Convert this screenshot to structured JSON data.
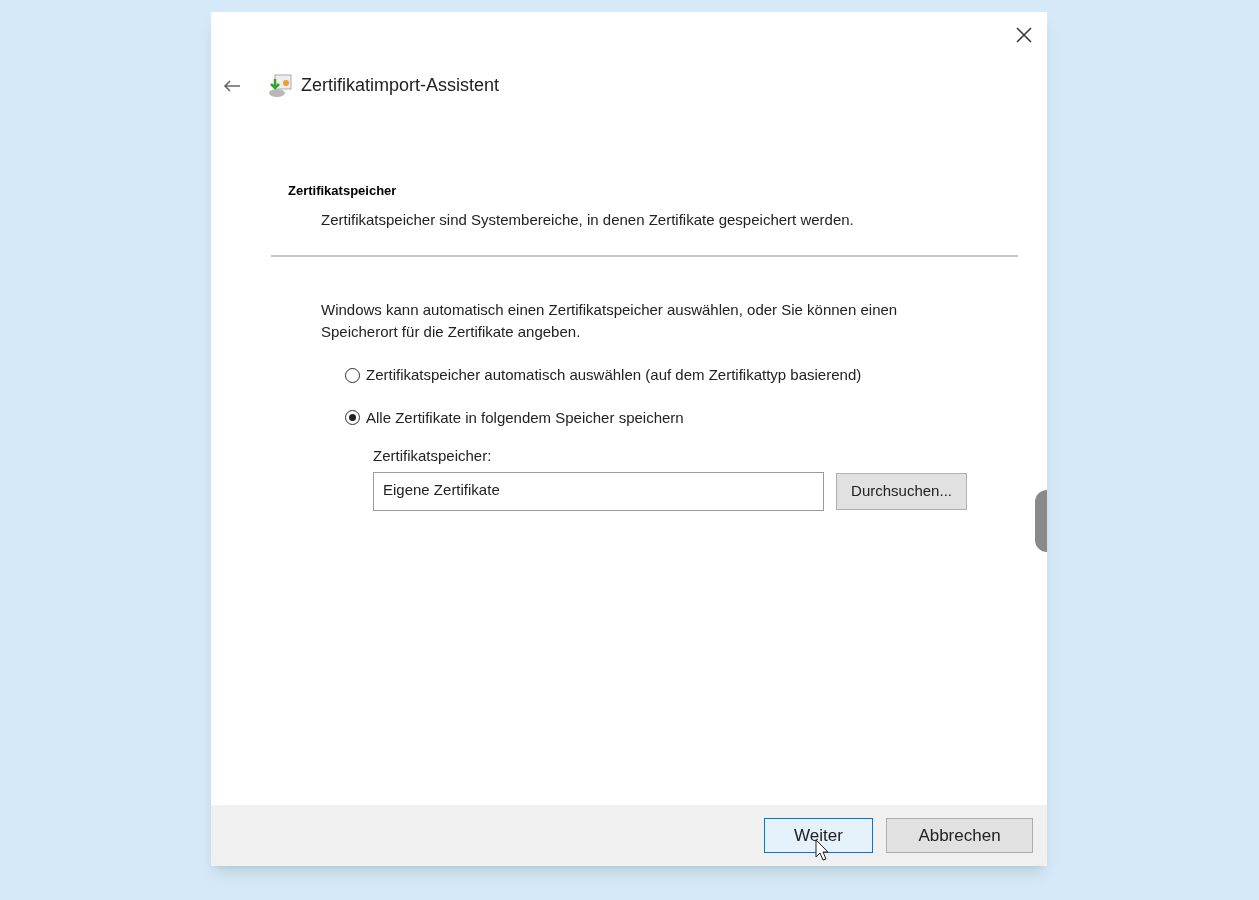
{
  "window": {
    "title": "Zertifikatimport-Assistent"
  },
  "section": {
    "heading": "Zertifikatspeicher",
    "description": "Zertifikatspeicher sind Systembereiche, in denen Zertifikate gespeichert werden."
  },
  "intro": "Windows kann automatisch einen Zertifikatspeicher auswählen, oder Sie können einen Speicherort für die Zertifikate angeben.",
  "options": [
    {
      "label": "Zertifikatspeicher automatisch auswählen (auf dem Zertifikattyp basierend)",
      "selected": false
    },
    {
      "label": "Alle Zertifikate in folgendem Speicher speichern",
      "selected": true
    }
  ],
  "store": {
    "label": "Zertifikatspeicher:",
    "value": "Eigene Zertifikate",
    "browse_button": "Durchsuchen..."
  },
  "buttons": [
    {
      "label": "Weiter",
      "focused": true
    },
    {
      "label": "Abbrechen",
      "focused": false
    }
  ]
}
